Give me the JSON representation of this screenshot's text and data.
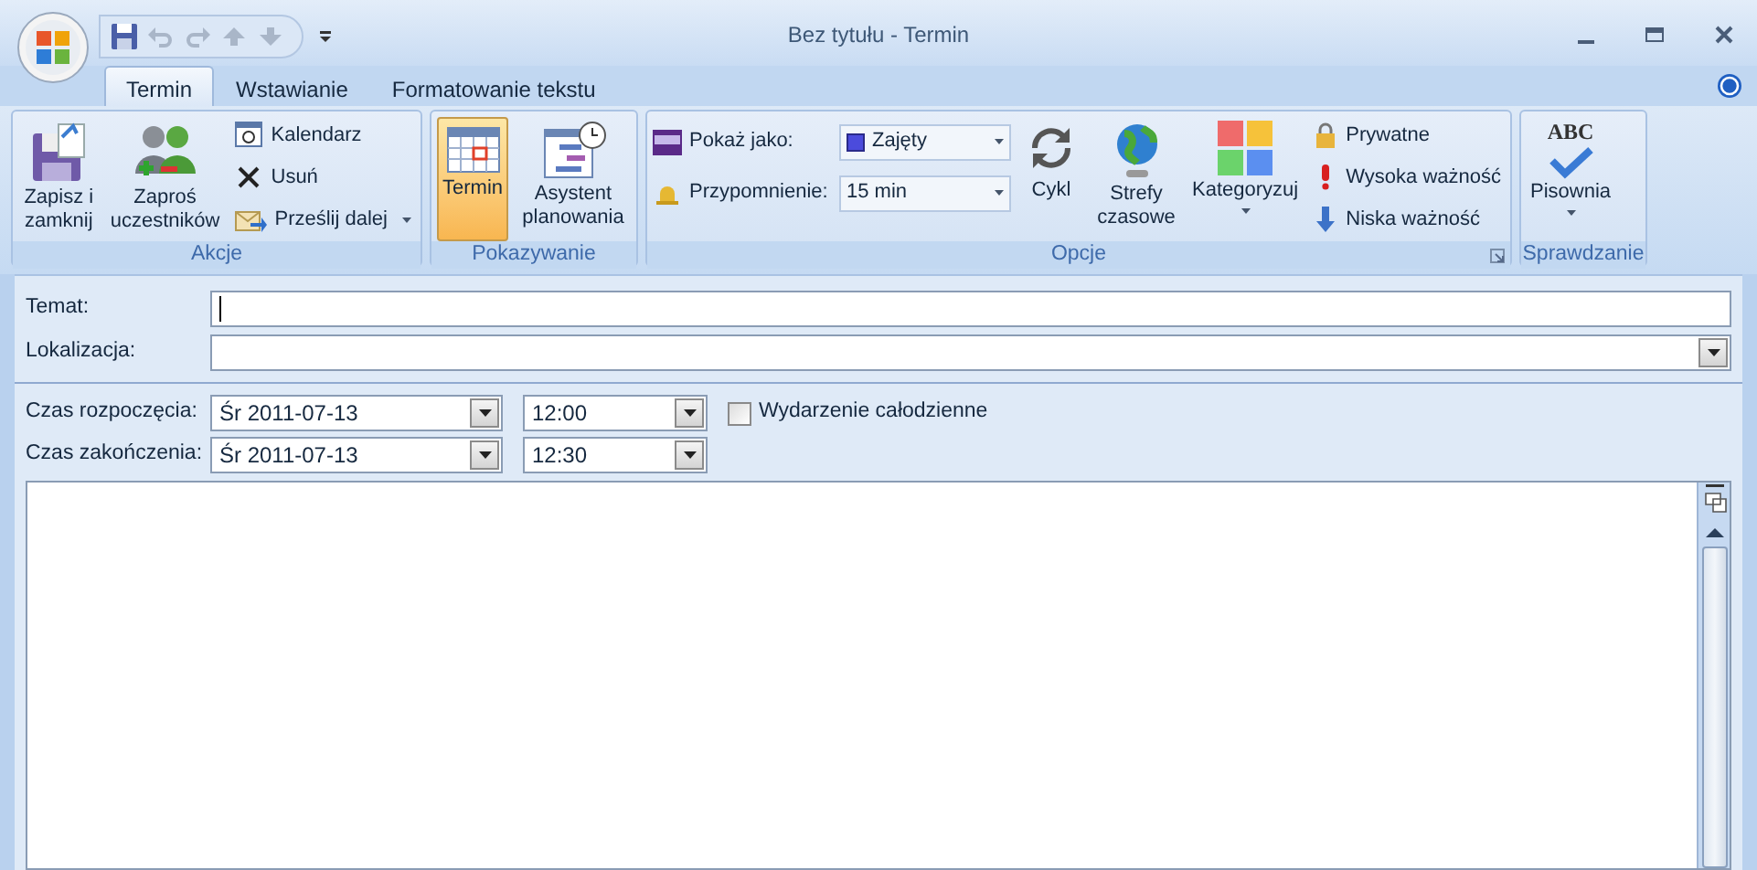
{
  "window": {
    "title": "Bez tytułu - Termin"
  },
  "tabs": [
    {
      "label": "Termin",
      "selected": true
    },
    {
      "label": "Wstawianie",
      "selected": false
    },
    {
      "label": "Formatowanie tekstu",
      "selected": false
    }
  ],
  "ribbon": [
    {
      "label": "Akcje",
      "items": [
        {
          "kind": "large",
          "label": "Zapisz i zamknij",
          "dropdown": false
        },
        {
          "kind": "large",
          "label": "Zaproś uczestników",
          "dropdown": false
        },
        {
          "kind": "small",
          "label": "Kalendarz",
          "dropdown": false
        },
        {
          "kind": "small",
          "label": "Usuń",
          "dropdown": false
        },
        {
          "kind": "small",
          "label": "Prześlij dalej",
          "dropdown": true
        }
      ]
    },
    {
      "label": "Pokazywanie",
      "items": [
        {
          "kind": "large",
          "label": "Termin",
          "selected": true,
          "dropdown": false
        },
        {
          "kind": "large",
          "label": "Asystent planowania",
          "selected": false,
          "dropdown": false
        }
      ]
    },
    {
      "label": "Opcje",
      "launcher": true,
      "items": [
        {
          "kind": "field",
          "label": "Pokaż jako:",
          "value": "Zajęty",
          "color": "#4b4bdc",
          "dropdown": true
        },
        {
          "kind": "field",
          "label": "Przypomnienie:",
          "value": "15 min",
          "dropdown": true
        },
        {
          "kind": "large",
          "label": "Cykl",
          "dropdown": false
        },
        {
          "kind": "large",
          "label": "Strefy czasowe",
          "dropdown": false
        },
        {
          "kind": "large",
          "label": "Kategoryzuj",
          "dropdown": true
        },
        {
          "kind": "small",
          "label": "Prywatne",
          "dropdown": false
        },
        {
          "kind": "small",
          "label": "Wysoka ważność",
          "dropdown": false
        },
        {
          "kind": "small",
          "label": "Niska ważność",
          "dropdown": false
        }
      ]
    },
    {
      "label": "Sprawdzanie",
      "items": [
        {
          "kind": "large",
          "label": "Pisownia",
          "icon_text": "ABC",
          "dropdown": true
        }
      ]
    }
  ],
  "form": {
    "subject": {
      "label": "Temat:"
    },
    "location": {
      "label": "Lokalizacja:"
    },
    "start": {
      "label": "Czas rozpoczęcia:",
      "date": "Śr 2011-07-13",
      "time": "12:00"
    },
    "all_day": {
      "label": "Wydarzenie całodzienne",
      "checked": false
    },
    "end": {
      "label": "Czas zakończenia:",
      "date": "Śr 2011-07-13",
      "time": "12:30"
    }
  }
}
